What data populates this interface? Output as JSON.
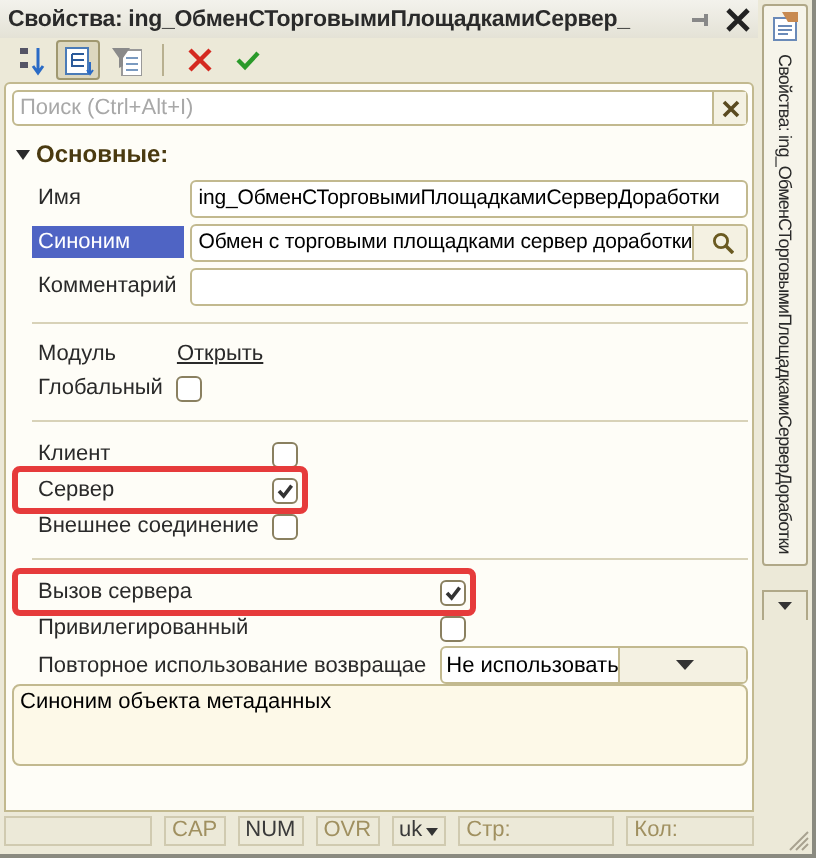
{
  "window": {
    "title": "Свойства: ing_ОбменСТорговымиПлощадкамиСервер_"
  },
  "toolbar": [
    {
      "kind": "sort",
      "selected": false
    },
    {
      "kind": "tree",
      "selected": true
    },
    {
      "kind": "filter",
      "selected": false
    },
    {
      "kind": "delete",
      "selected": false
    },
    {
      "kind": "apply",
      "selected": false
    }
  ],
  "search": {
    "placeholder": "Поиск (Ctrl+Alt+I)"
  },
  "section": {
    "title": "Основные:",
    "expanded": true
  },
  "groups": [
    {
      "rows": [
        {
          "kind": "text",
          "label": "Имя",
          "value": "ing_ОбменСТорговымиПлощадкамиСерверДоработки",
          "selected": false,
          "has_button": false
        },
        {
          "kind": "text",
          "label": "Синоним",
          "value": "Обмен с торговыми площадками сервер доработки",
          "selected": true,
          "has_button": true
        },
        {
          "kind": "text",
          "label": "Комментарий",
          "selected": false,
          "has_button": false
        }
      ]
    },
    {
      "rows": [
        {
          "kind": "link",
          "label": "Модуль",
          "link": "Открыть",
          "selected": false
        },
        {
          "kind": "checkbox",
          "label": "Глобальный",
          "checked": false,
          "selected": false,
          "highlighted": false
        }
      ]
    },
    {
      "rows": [
        {
          "kind": "checkbox",
          "label": "Клиент",
          "checked": false,
          "selected": false,
          "highlighted": false
        },
        {
          "kind": "checkbox",
          "label": "Сервер",
          "checked": true,
          "selected": false,
          "highlighted": true
        },
        {
          "kind": "checkbox",
          "label": "Внешнее соединение",
          "checked": false,
          "selected": false,
          "highlighted": false
        }
      ]
    },
    {
      "rows": [
        {
          "kind": "checkbox",
          "label": "Вызов сервера",
          "checked": true,
          "selected": false,
          "highlighted": true
        },
        {
          "kind": "checkbox",
          "label": "Привилегированный",
          "checked": false,
          "selected": false,
          "highlighted": false
        },
        {
          "kind": "dropdown",
          "label": "Повторное использование возвращае",
          "value": "Не использовать",
          "selected": false
        }
      ]
    }
  ],
  "description": "Синоним объекта метаданных",
  "status_bar": [
    {
      "kind": "blank"
    },
    {
      "kind": "indicator",
      "text": "CAP",
      "enabled": false
    },
    {
      "kind": "indicator",
      "text": "NUM",
      "enabled": true
    },
    {
      "kind": "indicator",
      "text": "OVR",
      "enabled": false
    },
    {
      "kind": "language",
      "text": "uk"
    },
    {
      "kind": "indicator",
      "text": "Стр:",
      "enabled": false
    },
    {
      "kind": "indicator",
      "text": "Кол:",
      "enabled": false
    }
  ],
  "side_tab": {
    "label": "Свойства: ing_ОбменСТорговымиПлощадкамиСерверДоработки"
  }
}
